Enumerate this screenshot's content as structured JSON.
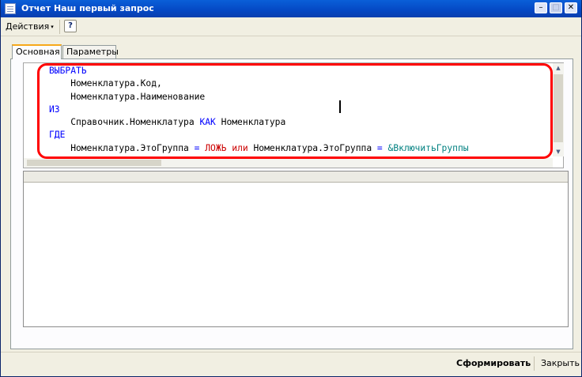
{
  "window": {
    "title": "Отчет  Наш первый запрос",
    "minimize": "–",
    "maximize": "□",
    "close": "✕"
  },
  "toolbar": {
    "actions_label": "Действия",
    "actions_arrow": "▾",
    "help_label": "?"
  },
  "tabs": [
    {
      "label": "Основная",
      "active": true
    },
    {
      "label": "Параметры",
      "active": false
    }
  ],
  "query": {
    "lines": [
      [
        {
          "text": "ВЫБРАТЬ",
          "style": "kw"
        }
      ],
      [
        {
          "text": "    Номенклатура.Код,",
          "style": "plain"
        }
      ],
      [
        {
          "text": "    Номенклатура.Наименование",
          "style": "plain"
        }
      ],
      [
        {
          "text": "ИЗ",
          "style": "kw"
        }
      ],
      [
        {
          "text": "    Справочник.Номенклатура ",
          "style": "plain"
        },
        {
          "text": "КАК",
          "style": "kw"
        },
        {
          "text": " Номенклатура",
          "style": "plain"
        }
      ],
      [
        {
          "text": "ГДЕ",
          "style": "kw"
        }
      ],
      [
        {
          "text": "    Номенклатура.ЭтоГруппа ",
          "style": "plain"
        },
        {
          "text": "=",
          "style": "kw"
        },
        {
          "text": " ЛОЖЬ",
          "style": "red"
        },
        {
          "text": " или",
          "style": "red"
        },
        {
          "text": " Номенклатура.ЭтоГруппа ",
          "style": "plain"
        },
        {
          "text": "=",
          "style": "kw"
        },
        {
          "text": " &ВключитьГруппы",
          "style": "teal"
        }
      ]
    ],
    "highlight_color": "#ff0000"
  },
  "scrollbar_arrows": {
    "up": "▲",
    "down": "▼"
  },
  "bottom": {
    "generate_label": "Сформировать",
    "close_label": "Закрыть"
  }
}
